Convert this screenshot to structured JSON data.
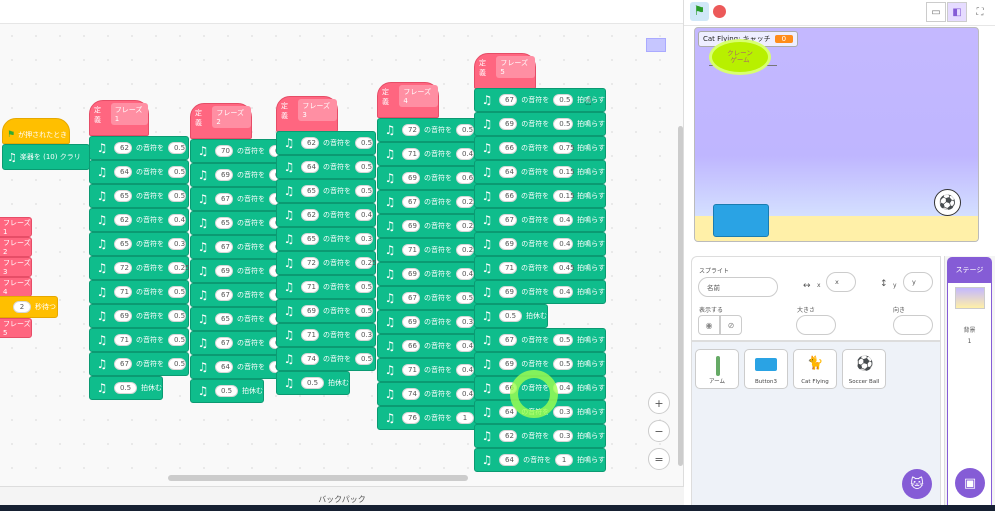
{
  "toolbar": {
    "flag_icon": "green-flag-icon",
    "stop_icon": "stop-icon"
  },
  "stage": {
    "variable_label": "Cat Flying: キャッチ",
    "variable_value": "0",
    "arm_label_line1": "クレーン",
    "arm_label_line2": "ゲーム"
  },
  "workspace": {
    "when_flag": "が押されたとき",
    "instrument_block": "楽器を (10) クラリ",
    "left_hats": [
      "フレーズ1",
      "フレーズ2",
      "フレーズ3",
      "フレーズ4",
      "フレーズ5"
    ],
    "wait_value": "2",
    "wait_label": "秒待つ",
    "define": "定義",
    "note_label": "の音符を",
    "beat_label": "拍鳴らす",
    "rest_label": "拍休む",
    "backpack": "バックパック",
    "phrases": [
      {
        "name": "フレーズ1",
        "notes": [
          [
            "62",
            "0.5"
          ],
          [
            "64",
            "0.5"
          ],
          [
            "65",
            "0.5"
          ],
          [
            "62",
            "0.4"
          ],
          [
            "65",
            "0.3"
          ],
          [
            "72",
            "0.25"
          ],
          [
            "71",
            "0.5"
          ],
          [
            "69",
            "0.5"
          ],
          [
            "71",
            "0.5"
          ],
          [
            "67",
            "0.5"
          ]
        ],
        "rest": "0.5"
      },
      {
        "name": "フレーズ2",
        "notes": [
          [
            "70",
            "0.5"
          ],
          [
            "69",
            "0.5"
          ],
          [
            "67",
            "0.5"
          ],
          [
            "65",
            "0.5"
          ],
          [
            "67",
            "0.5"
          ],
          [
            "69",
            "0.5"
          ],
          [
            "67",
            "0.5"
          ],
          [
            "65",
            "0.5"
          ],
          [
            "67",
            "0.5"
          ],
          [
            "64",
            "0.5"
          ]
        ],
        "rest": "0.5"
      },
      {
        "name": "フレーズ3",
        "notes": [
          [
            "62",
            "0.5"
          ],
          [
            "64",
            "0.5"
          ],
          [
            "65",
            "0.5"
          ],
          [
            "62",
            "0.4"
          ],
          [
            "65",
            "0.3"
          ],
          [
            "72",
            "0.25"
          ],
          [
            "71",
            "0.5"
          ],
          [
            "69",
            "0.5"
          ],
          [
            "71",
            "0.3"
          ],
          [
            "74",
            "0.5"
          ]
        ],
        "rest": "0.5"
      },
      {
        "name": "フレーズ4",
        "notes": [
          [
            "72",
            "0.5"
          ],
          [
            "71",
            "0.4"
          ],
          [
            "69",
            "0.6"
          ],
          [
            "67",
            "0.25"
          ],
          [
            "69",
            "0.25"
          ],
          [
            "71",
            "0.25"
          ],
          [
            "69",
            "0.4"
          ],
          [
            "67",
            "0.5"
          ],
          [
            "69",
            "0.35"
          ],
          [
            "66",
            "0.4"
          ],
          [
            "71",
            "0.4"
          ],
          [
            "74",
            "0.4"
          ],
          [
            "76",
            "1"
          ]
        ],
        "rest": ""
      },
      {
        "name": "フレーズ5",
        "notes": [
          [
            "67",
            "0.5"
          ],
          [
            "69",
            "0.5"
          ],
          [
            "66",
            "0.75"
          ],
          [
            "64",
            "0.15"
          ],
          [
            "66",
            "0.15"
          ],
          [
            "67",
            "0.4"
          ],
          [
            "69",
            "0.4"
          ],
          [
            "71",
            "0.45"
          ],
          [
            "69",
            "0.4"
          ]
        ],
        "rest": "0.5",
        "notes2": [
          [
            "67",
            "0.5"
          ],
          [
            "69",
            "0.5"
          ],
          [
            "66",
            "0.4"
          ],
          [
            "64",
            "0.3"
          ],
          [
            "62",
            "0.3"
          ],
          [
            "64",
            "1"
          ]
        ]
      }
    ]
  },
  "sprite_info": {
    "title": "スプライト",
    "name_placeholder": "名前",
    "x_label": "x",
    "x_value": "x",
    "y_label": "y",
    "y_value": "y",
    "show_label": "表示する",
    "size_label": "大きさ",
    "direction_label": "向き"
  },
  "sprites": [
    {
      "name": "アーム",
      "icon": "arm-icon"
    },
    {
      "name": "Button3",
      "icon": "button-icon"
    },
    {
      "name": "Cat Flying",
      "icon": "cat-icon"
    },
    {
      "name": "Soccer Ball",
      "icon": "soccer-ball-icon"
    }
  ],
  "stage_panel": {
    "title": "ステージ",
    "backdrop_label": "背景",
    "backdrop_count": "1"
  },
  "zoom": {
    "in": "+",
    "out": "−",
    "reset": "="
  }
}
